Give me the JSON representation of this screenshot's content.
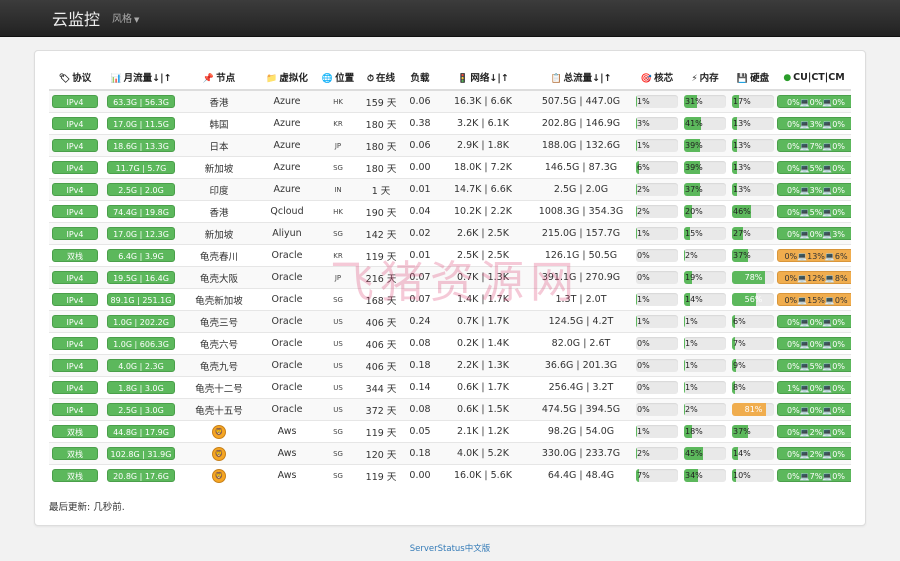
{
  "nav": {
    "brand": "云监控",
    "style_menu": "风格"
  },
  "headers": {
    "protocol": "协议",
    "monthly_traffic": "月流量↓|↑",
    "node": "节点",
    "virtualization": "虚拟化",
    "location": "位置",
    "online": "在线",
    "load": "负载",
    "network": "网络↓|↑",
    "total_traffic": "总流量↓|↑",
    "cores": "核芯",
    "memory": "内存",
    "disk": "硬盘",
    "cu_ct_cm": "CU|CT|CM"
  },
  "rows": [
    {
      "protocol": "IPv4",
      "monthly": "63.3G | 56.3G",
      "node": "香港",
      "virt": "Azure",
      "loc": "HK",
      "online": "159 天",
      "load": "0.06",
      "network": "16.3K | 6.6K",
      "total": "507.5G | 447.0G",
      "cpu": 1,
      "cpu_label": "1%",
      "mem": 31,
      "mem_label": "31%",
      "disk": 17,
      "disk_label": "17%",
      "cm": "0%💻0%💻0%",
      "cm_warn": false
    },
    {
      "protocol": "IPv4",
      "monthly": "17.0G | 11.5G",
      "node": "韩国",
      "virt": "Azure",
      "loc": "KR",
      "online": "180 天",
      "load": "0.38",
      "network": "3.2K | 6.1K",
      "total": "202.8G | 146.9G",
      "cpu": 3,
      "cpu_label": "3%",
      "mem": 41,
      "mem_label": "41%",
      "disk": 13,
      "disk_label": "13%",
      "cm": "0%💻3%💻0%",
      "cm_warn": false
    },
    {
      "protocol": "IPv4",
      "monthly": "18.6G | 13.3G",
      "node": "日本",
      "virt": "Azure",
      "loc": "JP",
      "online": "180 天",
      "load": "0.06",
      "network": "2.9K | 1.8K",
      "total": "188.0G | 132.6G",
      "cpu": 1,
      "cpu_label": "1%",
      "mem": 39,
      "mem_label": "39%",
      "disk": 13,
      "disk_label": "13%",
      "cm": "0%💻7%💻0%",
      "cm_warn": false
    },
    {
      "protocol": "IPv4",
      "monthly": "11.7G | 5.7G",
      "node": "新加坡",
      "virt": "Azure",
      "loc": "SG",
      "online": "180 天",
      "load": "0.00",
      "network": "18.0K | 7.2K",
      "total": "146.5G | 87.3G",
      "cpu": 6,
      "cpu_label": "6%",
      "mem": 39,
      "mem_label": "39%",
      "disk": 13,
      "disk_label": "13%",
      "cm": "0%💻5%💻0%",
      "cm_warn": false
    },
    {
      "protocol": "IPv4",
      "monthly": "2.5G | 2.0G",
      "node": "印度",
      "virt": "Azure",
      "loc": "IN",
      "online": "1 天",
      "load": "0.01",
      "network": "14.7K | 6.6K",
      "total": "2.5G | 2.0G",
      "cpu": 2,
      "cpu_label": "2%",
      "mem": 37,
      "mem_label": "37%",
      "disk": 13,
      "disk_label": "13%",
      "cm": "0%💻3%💻0%",
      "cm_warn": false
    },
    {
      "protocol": "IPv4",
      "monthly": "74.4G | 19.8G",
      "node": "香港",
      "virt": "Qcloud",
      "loc": "HK",
      "online": "190 天",
      "load": "0.04",
      "network": "10.2K | 2.2K",
      "total": "1008.3G | 354.3G",
      "cpu": 2,
      "cpu_label": "2%",
      "mem": 20,
      "mem_label": "20%",
      "disk": 46,
      "disk_label": "46%",
      "cm": "0%💻5%💻0%",
      "cm_warn": false
    },
    {
      "protocol": "IPv4",
      "monthly": "17.0G | 12.3G",
      "node": "新加坡",
      "virt": "Aliyun",
      "loc": "SG",
      "online": "142 天",
      "load": "0.02",
      "network": "2.6K | 2.5K",
      "total": "215.0G | 157.7G",
      "cpu": 1,
      "cpu_label": "1%",
      "mem": 15,
      "mem_label": "15%",
      "disk": 27,
      "disk_label": "27%",
      "cm": "0%💻0%💻3%",
      "cm_warn": false
    },
    {
      "protocol": "双栈",
      "monthly": "6.4G | 3.9G",
      "node": "龟壳春川",
      "virt": "Oracle",
      "loc": "KR",
      "online": "119 天",
      "load": "0.01",
      "network": "2.5K | 2.5K",
      "total": "126.1G | 50.5G",
      "cpu": 0,
      "cpu_label": "0%",
      "mem": 2,
      "mem_label": "2%",
      "disk": 37,
      "disk_label": "37%",
      "cm": "0%💻13%💻6%",
      "cm_warn": true
    },
    {
      "protocol": "IPv4",
      "monthly": "19.5G | 16.4G",
      "node": "龟壳大阪",
      "virt": "Oracle",
      "loc": "JP",
      "online": "216 天",
      "load": "0.07",
      "network": "0.7K | 1.3K",
      "total": "391.1G | 270.9G",
      "cpu": 0,
      "cpu_label": "0%",
      "mem": 19,
      "mem_label": "19%",
      "disk": 78,
      "disk_label": "78%",
      "cm": "0%💻12%💻8%",
      "cm_warn": true
    },
    {
      "protocol": "IPv4",
      "monthly": "89.1G | 251.1G",
      "node": "龟壳新加坡",
      "virt": "Oracle",
      "loc": "SG",
      "online": "168 天",
      "load": "0.07",
      "network": "1.4K | 1.7K",
      "total": "1.3T | 2.0T",
      "cpu": 1,
      "cpu_label": "1%",
      "mem": 14,
      "mem_label": "14%",
      "disk": 56,
      "disk_label": "56%",
      "cm": "0%💻15%💻0%",
      "cm_warn": true
    },
    {
      "protocol": "IPv4",
      "monthly": "1.0G | 202.2G",
      "node": "龟壳三号",
      "virt": "Oracle",
      "loc": "US",
      "online": "406 天",
      "load": "0.24",
      "network": "0.7K | 1.7K",
      "total": "124.5G | 4.2T",
      "cpu": 1,
      "cpu_label": "1%",
      "mem": 1,
      "mem_label": "1%",
      "disk": 6,
      "disk_label": "6%",
      "cm": "0%💻0%💻0%",
      "cm_warn": false
    },
    {
      "protocol": "IPv4",
      "monthly": "1.0G | 606.3G",
      "node": "龟壳六号",
      "virt": "Oracle",
      "loc": "US",
      "online": "406 天",
      "load": "0.08",
      "network": "0.2K | 1.4K",
      "total": "82.0G | 2.6T",
      "cpu": 0,
      "cpu_label": "0%",
      "mem": 1,
      "mem_label": "1%",
      "disk": 7,
      "disk_label": "7%",
      "cm": "0%💻0%💻0%",
      "cm_warn": false
    },
    {
      "protocol": "IPv4",
      "monthly": "4.0G | 2.3G",
      "node": "龟壳九号",
      "virt": "Oracle",
      "loc": "US",
      "online": "406 天",
      "load": "0.18",
      "network": "2.2K | 1.3K",
      "total": "36.6G | 201.3G",
      "cpu": 0,
      "cpu_label": "0%",
      "mem": 1,
      "mem_label": "1%",
      "disk": 9,
      "disk_label": "9%",
      "cm": "0%💻5%💻0%",
      "cm_warn": false
    },
    {
      "protocol": "IPv4",
      "monthly": "1.8G | 3.0G",
      "node": "龟壳十二号",
      "virt": "Oracle",
      "loc": "US",
      "online": "344 天",
      "load": "0.14",
      "network": "0.6K | 1.7K",
      "total": "256.4G | 3.2T",
      "cpu": 0,
      "cpu_label": "0%",
      "mem": 1,
      "mem_label": "1%",
      "disk": 8,
      "disk_label": "8%",
      "cm": "1%💻0%💻0%",
      "cm_warn": false
    },
    {
      "protocol": "IPv4",
      "monthly": "2.5G | 3.0G",
      "node": "龟壳十五号",
      "virt": "Oracle",
      "loc": "US",
      "online": "372 天",
      "load": "0.08",
      "network": "0.6K | 1.5K",
      "total": "474.5G | 394.5G",
      "cpu": 0,
      "cpu_label": "0%",
      "mem": 2,
      "mem_label": "2%",
      "disk": 81,
      "disk_label": "81%",
      "cm": "0%💻0%💻0%",
      "cm_warn": false
    },
    {
      "protocol": "双栈",
      "monthly": "44.8G | 17.9G",
      "node": "",
      "node_icon": "lion-icon",
      "virt": "Aws",
      "loc": "SG",
      "online": "119 天",
      "load": "0.05",
      "network": "2.1K | 1.2K",
      "total": "98.2G | 54.0G",
      "cpu": 1,
      "cpu_label": "1%",
      "mem": 18,
      "mem_label": "18%",
      "disk": 37,
      "disk_label": "37%",
      "cm": "0%💻2%💻0%",
      "cm_warn": false
    },
    {
      "protocol": "双栈",
      "monthly": "102.8G | 31.9G",
      "node": "",
      "node_icon": "lion-icon",
      "virt": "Aws",
      "loc": "SG",
      "online": "120 天",
      "load": "0.18",
      "network": "4.0K | 5.2K",
      "total": "330.0G | 233.7G",
      "cpu": 2,
      "cpu_label": "2%",
      "mem": 45,
      "mem_label": "45%",
      "disk": 14,
      "disk_label": "14%",
      "cm": "0%💻2%💻0%",
      "cm_warn": false
    },
    {
      "protocol": "双栈",
      "monthly": "20.8G | 17.6G",
      "node": "",
      "node_icon": "lion-icon",
      "virt": "Aws",
      "loc": "SG",
      "online": "119 天",
      "load": "0.00",
      "network": "16.0K | 5.6K",
      "total": "64.4G | 48.4G",
      "cpu": 7,
      "cpu_label": "7%",
      "mem": 34,
      "mem_label": "34%",
      "disk": 10,
      "disk_label": "10%",
      "cm": "0%💻7%💻0%",
      "cm_warn": false
    }
  ],
  "last_update": "最后更新: 几秒前.",
  "credit": "ServerStatus中文版",
  "watermark": "飞猪资源网",
  "colors": {
    "green": "#5cb85c",
    "warn": "#f0ad4e",
    "navbar": "#2a2a2a",
    "link": "#337ab7"
  }
}
